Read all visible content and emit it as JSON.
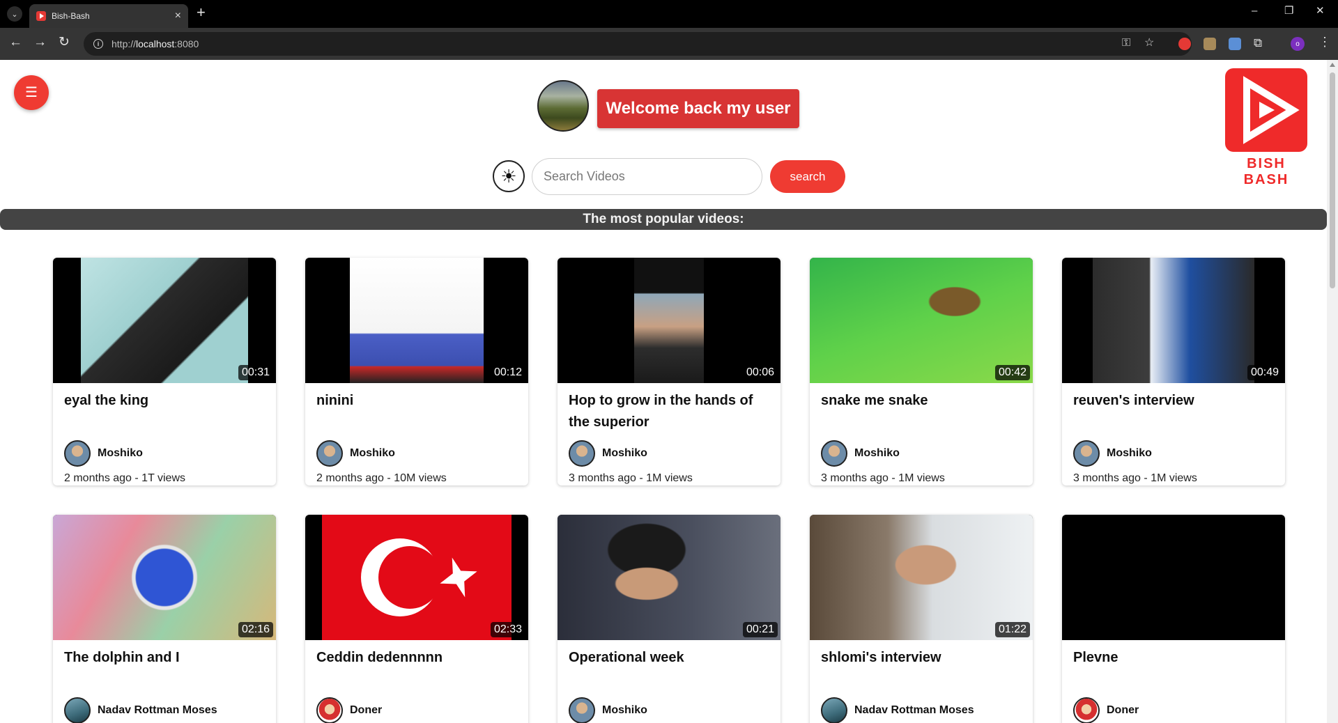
{
  "browser": {
    "tab_title": "Bish-Bash",
    "url_scheme": "http://",
    "url_host": "localhost",
    "url_port": ":8080"
  },
  "header": {
    "welcome": "Welcome back my user",
    "logo_text": "BISH BASH"
  },
  "search": {
    "placeholder": "Search Videos",
    "button_label": "search"
  },
  "section_title": "The most popular videos:",
  "colors": {
    "accent": "#ef3b32",
    "welcome_bg": "#d83434",
    "logo_red": "#ef2a2a",
    "section_bar": "#444444"
  },
  "videos": [
    {
      "title": "eyal the king",
      "duration": "00:31",
      "channel": "Moshiko",
      "meta": "2 months ago - 1T views"
    },
    {
      "title": "ninini",
      "duration": "00:12",
      "channel": "Moshiko",
      "meta": "2 months ago - 10M views"
    },
    {
      "title": "Hop to grow in the hands of the superior",
      "duration": "00:06",
      "channel": "Moshiko",
      "meta": "3 months ago - 1M views"
    },
    {
      "title": "snake me snake",
      "duration": "00:42",
      "channel": "Moshiko",
      "meta": "3 months ago - 1M views"
    },
    {
      "title": "reuven's interview",
      "duration": "00:49",
      "channel": "Moshiko",
      "meta": "3 months ago - 1M views"
    },
    {
      "title": "The dolphin and I",
      "duration": "02:16",
      "channel": "Nadav Rottman Moses",
      "meta": ""
    },
    {
      "title": "Ceddin dedennnnn",
      "duration": "02:33",
      "channel": "Doner",
      "meta": ""
    },
    {
      "title": "Operational week",
      "duration": "00:21",
      "channel": "Moshiko",
      "meta": ""
    },
    {
      "title": "shlomi's interview",
      "duration": "01:22",
      "channel": "Nadav Rottman Moses",
      "meta": ""
    },
    {
      "title": "Plevne",
      "duration": "",
      "channel": "Doner",
      "meta": ""
    }
  ]
}
